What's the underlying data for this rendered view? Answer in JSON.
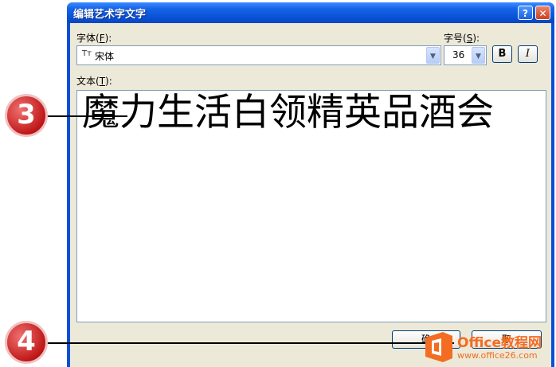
{
  "dialog": {
    "title": "编辑艺术字文字",
    "help_label": "?",
    "close_label": "✕",
    "font_label": "字体",
    "font_accel": "F",
    "font_value": "宋体",
    "font_icon_text": "Tт",
    "size_label": "字号",
    "size_accel": "S",
    "size_value": "36",
    "bold_label": "B",
    "italic_label": "I",
    "text_label": "文本",
    "text_accel": "T",
    "text_value": "魔力生活白领精英品酒会",
    "ok_label": "确",
    "cancel_label": "取"
  },
  "callouts": {
    "step3": "3",
    "step4": "4"
  },
  "watermark": {
    "line1": "Office教程网",
    "line2": "www.office26.com"
  },
  "colors": {
    "title_bar": "#0a52d6",
    "client_bg": "#ece9d8",
    "callout": "#c01818",
    "watermark_orange": "#f36c21"
  }
}
